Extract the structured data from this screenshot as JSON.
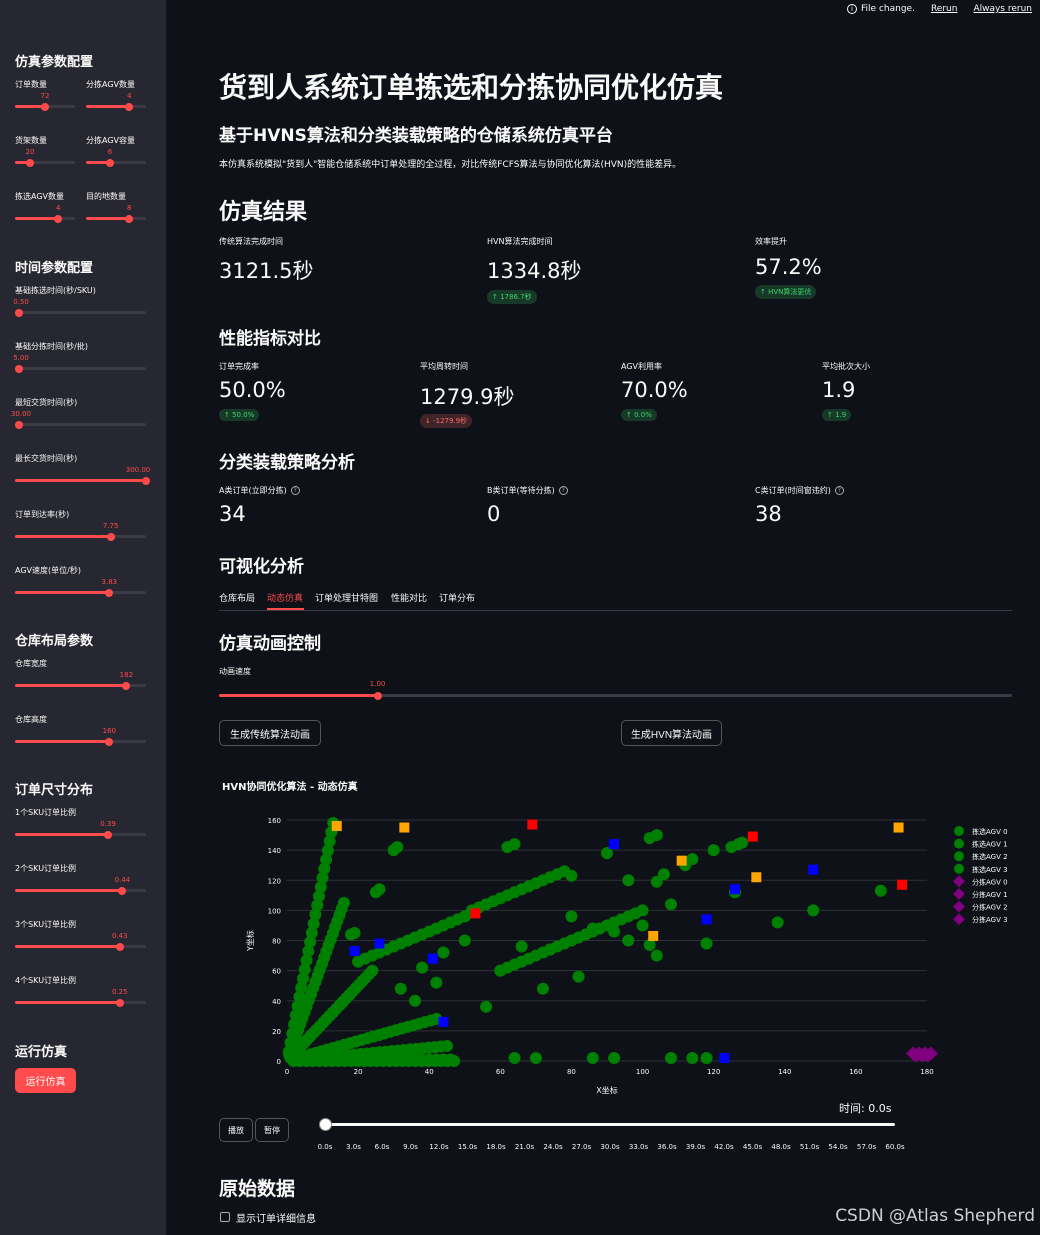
{
  "topbar": {
    "file_change": "File change.",
    "rerun": "Rerun",
    "always_rerun": "Always rerun"
  },
  "sidebar": {
    "sim_header": "仿真参数配置",
    "time_header": "时间参数配置",
    "layout_header": "仓库布局参数",
    "order_header": "订单尺寸分布",
    "run_header": "运行仿真",
    "run_button": "运行仿真",
    "sliders": [
      {
        "label": "订单数量",
        "value": "72",
        "fraction": 0.5
      },
      {
        "label": "分拣AGV数量",
        "value": "4",
        "fraction": 0.72
      },
      {
        "label": "货架数量",
        "value": "20",
        "fraction": 0.25
      },
      {
        "label": "分拣AGV容量",
        "value": "6",
        "fraction": 0.4
      },
      {
        "label": "拣选AGV数量",
        "value": "4",
        "fraction": 0.72
      },
      {
        "label": "目的地数量",
        "value": "8",
        "fraction": 0.72
      },
      {
        "label": "基础拣选时间(秒/SKU)",
        "value": "0.50",
        "fraction": 0.0
      },
      {
        "label": "基础分拣时间(秒/批)",
        "value": "5.00",
        "fraction": 0.0
      },
      {
        "label": "最短交货时间(秒)",
        "value": "30.00",
        "fraction": 0.0
      },
      {
        "label": "最长交货时间(秒)",
        "value": "300.00",
        "fraction": 1.0
      },
      {
        "label": "订单到达率(秒)",
        "value": "7.75",
        "fraction": 0.73
      },
      {
        "label": "AGV速度(单位/秒)",
        "value": "3.83",
        "fraction": 0.72
      },
      {
        "label": "仓库宽度",
        "value": "182",
        "fraction": 0.85
      },
      {
        "label": "仓库高度",
        "value": "160",
        "fraction": 0.72
      },
      {
        "label": "1个SKU订单比例",
        "value": "0.39",
        "fraction": 0.71
      },
      {
        "label": "2个SKU订单比例",
        "value": "0.44",
        "fraction": 0.82
      },
      {
        "label": "3个SKU订单比例",
        "value": "0.43",
        "fraction": 0.8
      },
      {
        "label": "4个SKU订单比例",
        "value": "0.25",
        "fraction": 0.8
      }
    ]
  },
  "main": {
    "title": "货到人系统订单拣选和分拣协同优化仿真",
    "subtitle": "基于HVNS算法和分类装载策略的仓储系统仿真平台",
    "description": "本仿真系统模拟\"货到人\"智能仓储系统中订单处理的全过程，对比传统FCFS算法与协同优化算法(HVN)的性能差异。",
    "results_header": "仿真结果",
    "results": [
      {
        "label": "传统算法完成时间",
        "value": "3121.5秒",
        "delta": ""
      },
      {
        "label": "HVN算法完成时间",
        "value": "1334.8秒",
        "delta": "↑ 1786.7秒"
      },
      {
        "label": "效率提升",
        "value": "57.2%",
        "delta": "↑ HVN算法更优"
      }
    ],
    "perf_header": "性能指标对比",
    "perf": [
      {
        "label": "订单完成率",
        "value": "50.0%",
        "delta": "↑ 50.0%"
      },
      {
        "label": "平均周转时间",
        "value": "1279.9秒",
        "delta": "↓ -1279.9秒"
      },
      {
        "label": "AGV利用率",
        "value": "70.0%",
        "delta": "↑ 0.0%"
      },
      {
        "label": "平均批次大小",
        "value": "1.9",
        "delta": "↑ 1.9"
      }
    ],
    "strategy_header": "分类装载策略分析",
    "strategy": [
      {
        "label": "A类订单(立即分拣)",
        "value": "34"
      },
      {
        "label": "B类订单(等待分拣)",
        "value": "0"
      },
      {
        "label": "C类订单(时间窗违约)",
        "value": "38"
      }
    ],
    "viz_header": "可视化分析",
    "tabs": [
      "仓库布局",
      "动态仿真",
      "订单处理甘特图",
      "性能对比",
      "订单分布"
    ],
    "active_tab": 1,
    "anim_header": "仿真动画控制",
    "speed_label": "动画速度",
    "speed_value": "1.00",
    "speed_fraction": 0.2,
    "btn_traditional": "生成传统算法动画",
    "btn_hvn": "生成HVN算法动画",
    "raw_header": "原始数据",
    "show_details_label": "显示订单详细信息"
  },
  "chart_data": {
    "type": "scatter",
    "title": "HVN协同优化算法 - 动态仿真",
    "xlabel": "X坐标",
    "ylabel": "Y坐标",
    "xlim": [
      0,
      180
    ],
    "ylim": [
      0,
      160
    ],
    "xticks": [
      0,
      20,
      40,
      60,
      80,
      100,
      120,
      140,
      160,
      180
    ],
    "yticks": [
      0,
      20,
      40,
      60,
      80,
      100,
      120,
      140,
      160
    ],
    "legend": [
      "拣选AGV 0",
      "拣选AGV 1",
      "拣选AGV 2",
      "拣选AGV 3",
      "分拣AGV 0",
      "分拣AGV 1",
      "分拣AGV 2",
      "分拣AGV 3"
    ],
    "legend_position": "right",
    "green_rays": [
      [
        13,
        158
      ],
      [
        16,
        105
      ],
      [
        24,
        60
      ],
      [
        42,
        28
      ],
      [
        45,
        10
      ],
      [
        47,
        0
      ]
    ],
    "green_points": [
      [
        30,
        140
      ],
      [
        31,
        142
      ],
      [
        25,
        112
      ],
      [
        26,
        114
      ],
      [
        18,
        84
      ],
      [
        19,
        85
      ],
      [
        62,
        142
      ],
      [
        64,
        144
      ],
      [
        80,
        123
      ],
      [
        90,
        138
      ],
      [
        102,
        148
      ],
      [
        104,
        150
      ],
      [
        96,
        120
      ],
      [
        104,
        119
      ],
      [
        106,
        124
      ],
      [
        112,
        130
      ],
      [
        114,
        134
      ],
      [
        125,
        142
      ],
      [
        127,
        144
      ],
      [
        128,
        145
      ],
      [
        126,
        112
      ],
      [
        120,
        140
      ],
      [
        48,
        94
      ],
      [
        50,
        96
      ],
      [
        52,
        100
      ],
      [
        54,
        102
      ],
      [
        56,
        104
      ],
      [
        58,
        106
      ],
      [
        60,
        108
      ],
      [
        62,
        110
      ],
      [
        64,
        112
      ],
      [
        66,
        114
      ],
      [
        68,
        116
      ],
      [
        70,
        118
      ],
      [
        72,
        120
      ],
      [
        74,
        122
      ],
      [
        76,
        124
      ],
      [
        78,
        126
      ],
      [
        40,
        86
      ],
      [
        42,
        88
      ],
      [
        44,
        90
      ],
      [
        46,
        92
      ],
      [
        38,
        84
      ],
      [
        36,
        82
      ],
      [
        34,
        80
      ],
      [
        32,
        78
      ],
      [
        30,
        76
      ],
      [
        28,
        74
      ],
      [
        26,
        72
      ],
      [
        24,
        70
      ],
      [
        22,
        68
      ],
      [
        20,
        66
      ],
      [
        60,
        60
      ],
      [
        62,
        62
      ],
      [
        64,
        64
      ],
      [
        66,
        66
      ],
      [
        68,
        68
      ],
      [
        70,
        70
      ],
      [
        72,
        72
      ],
      [
        74,
        74
      ],
      [
        76,
        76
      ],
      [
        78,
        78
      ],
      [
        80,
        80
      ],
      [
        82,
        82
      ],
      [
        84,
        84
      ],
      [
        86,
        86
      ],
      [
        88,
        88
      ],
      [
        90,
        90
      ],
      [
        92,
        92
      ],
      [
        94,
        94
      ],
      [
        96,
        96
      ],
      [
        98,
        98
      ],
      [
        100,
        100
      ],
      [
        108,
        104
      ],
      [
        118,
        78
      ],
      [
        138,
        92
      ],
      [
        148,
        100
      ],
      [
        167,
        113
      ],
      [
        100,
        90
      ],
      [
        104,
        70
      ],
      [
        82,
        56
      ],
      [
        72,
        48
      ],
      [
        56,
        36
      ],
      [
        42,
        52
      ],
      [
        36,
        40
      ],
      [
        32,
        48
      ],
      [
        38,
        62
      ],
      [
        44,
        72
      ],
      [
        50,
        80
      ],
      [
        66,
        76
      ],
      [
        74,
        74
      ],
      [
        80,
        96
      ],
      [
        86,
        88
      ],
      [
        92,
        86
      ],
      [
        96,
        80
      ],
      [
        102,
        77
      ],
      [
        64,
        2
      ],
      [
        70,
        2
      ],
      [
        86,
        2
      ],
      [
        92,
        2
      ],
      [
        108,
        2
      ],
      [
        114,
        2
      ],
      [
        118,
        2
      ]
    ],
    "blue_squares": [
      [
        19,
        73
      ],
      [
        26,
        78
      ],
      [
        41,
        68
      ],
      [
        44,
        26
      ],
      [
        92,
        144
      ],
      [
        118,
        94
      ],
      [
        126,
        114
      ],
      [
        148,
        127
      ],
      [
        123,
        2
      ]
    ],
    "orange_squares": [
      [
        14,
        156
      ],
      [
        33,
        155
      ],
      [
        103,
        83
      ],
      [
        111,
        133
      ],
      [
        132,
        122
      ],
      [
        172,
        155
      ]
    ],
    "red_squares": [
      [
        53,
        98
      ],
      [
        69,
        157
      ],
      [
        131,
        149
      ],
      [
        173,
        117
      ]
    ],
    "purple_cluster": [
      180,
      5
    ],
    "slider": {
      "time_label": "时间: 0.0s",
      "play": "播放",
      "pause": "暂停",
      "ticks": [
        "0.0s",
        "3.0s",
        "6.0s",
        "9.0s",
        "12.0s",
        "15.0s",
        "18.0s",
        "21.0s",
        "24.0s",
        "27.0s",
        "30.0s",
        "33.0s",
        "36.0s",
        "39.0s",
        "42.0s",
        "45.0s",
        "48.0s",
        "51.0s",
        "54.0s",
        "57.0s",
        "60.0s"
      ]
    }
  },
  "watermark": "CSDN @Atlas Shepherd",
  "colors": {
    "accent": "#ff4b4b",
    "green": "#008000",
    "blue": "#0000ff",
    "orange": "#ffa500",
    "red": "#ff0000",
    "purple": "#800080"
  }
}
